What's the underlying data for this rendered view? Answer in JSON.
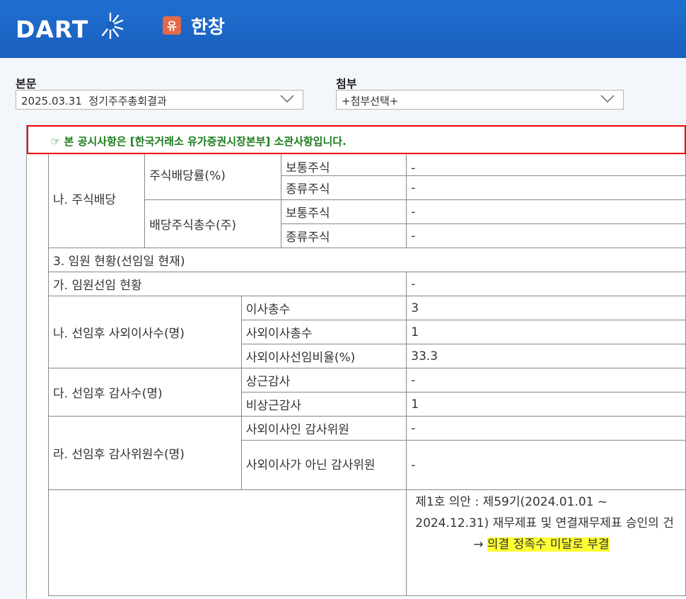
{
  "header": {
    "logo_text": "DART",
    "corp_badge": "유",
    "corp_name": "한창",
    "brand_colors": {
      "header_bg": "#1a5fbf",
      "badge": "#e36a4a"
    }
  },
  "body_select": {
    "label": "본문",
    "value": "2025.03.31  정기주주총회결과"
  },
  "attach_select": {
    "label": "첨부",
    "value": "+첨부선택+"
  },
  "notice": "☞ 본 공시사항은 [한국거래소 유가증권시장본부] 소관사항입니다.",
  "table": {
    "dividend": {
      "section": "나. 주식배당",
      "rate_label": "주식배당률(%)",
      "total_label": "배당주식총수(주)",
      "common_partial": "보통주식",
      "preferred1": "종류주식",
      "common": "보통주식",
      "preferred2": "종류주식",
      "v1": "-",
      "v2": "-",
      "v3": "-",
      "v4": "-"
    },
    "officers": {
      "section": "3. 임원 현황(선임일 현재)",
      "elect_label": "가. 임원선임 현황",
      "elect_value": "-",
      "outside_label": "나. 선임후 사외이사수(명)",
      "total_directors": "이사총수",
      "total_directors_v": "3",
      "outside_total": "사외이사총수",
      "outside_total_v": "1",
      "outside_ratio": "사외이사선임비율(%)",
      "outside_ratio_v": "33.3",
      "auditor_label": "다. 선임후 감사수(명)",
      "fulltime": "상근감사",
      "fulltime_v": "-",
      "parttime": "비상근감사",
      "parttime_v": "1",
      "committee_label": "라. 선임후 감사위원수(명)",
      "comm_outside": "사외이사인 감사위원",
      "comm_outside_v": "-",
      "comm_non_outside": "사외이사가 아닌 감사위원",
      "comm_non_outside_v": "-"
    },
    "agenda": {
      "text": "제1호 의안 : 제59기(2024.01.01 ~ 2024.12.31) 재무제표 및 연결재무제표 승인의 건",
      "arrow": "→",
      "result": "의결 정족수 미달로 부결"
    }
  }
}
